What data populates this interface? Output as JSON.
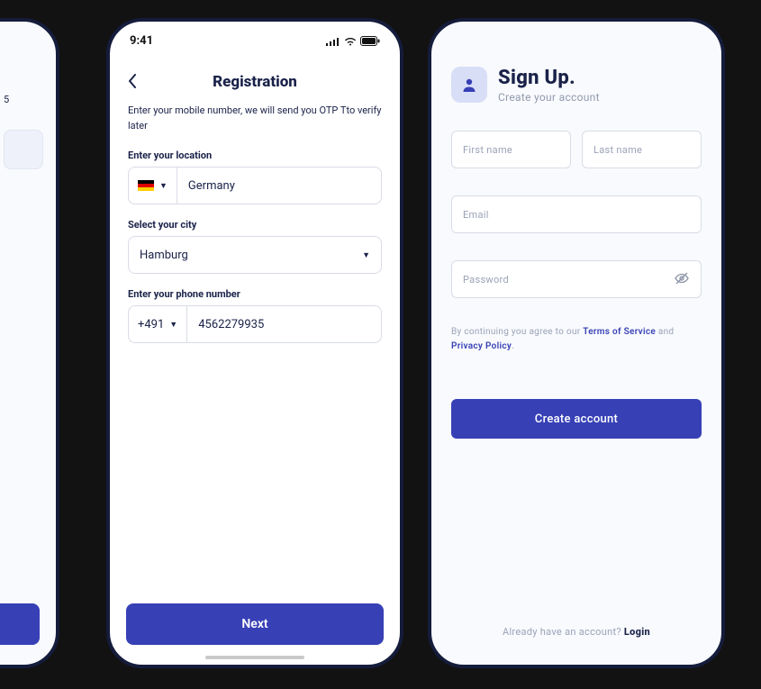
{
  "statusbar": {
    "time": "9:41"
  },
  "partial": {
    "text_fragment": "5"
  },
  "registration": {
    "title": "Registration",
    "subtitle": "Enter your mobile number, we will send you OTP Tto verify later",
    "location_label": "Enter your location",
    "location_value": "Germany",
    "city_label": "Select your city",
    "city_value": "Hamburg",
    "phone_label": "Enter your phone number",
    "phone_prefix": "+491",
    "phone_value": "4562279935",
    "next_btn": "Next"
  },
  "signup": {
    "title": "Sign Up.",
    "subtitle": "Create your account",
    "first_name_ph": "First name",
    "last_name_ph": "Last name",
    "email_ph": "Email",
    "password_ph": "Password",
    "terms_pre": "By continuing you agree to our ",
    "terms_tos": "Terms of Service",
    "terms_mid": " and ",
    "terms_pp": "Privacy Policy",
    "terms_end": ".",
    "create_btn": "Create account",
    "have_account": "Already have an account? ",
    "login": "Login"
  }
}
